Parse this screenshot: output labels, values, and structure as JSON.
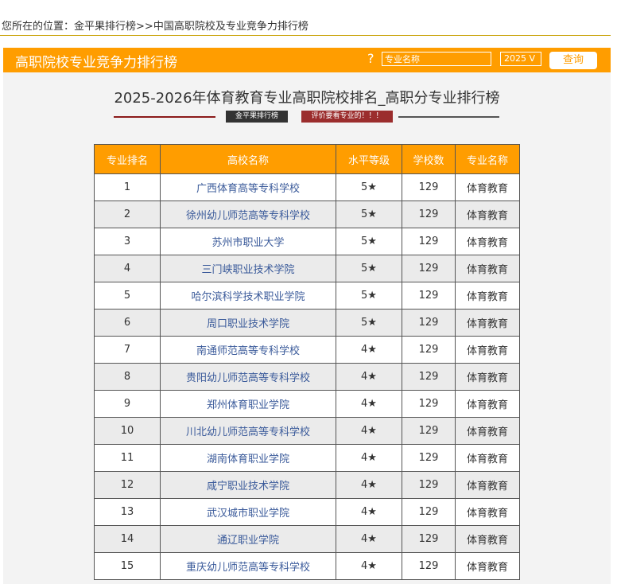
{
  "breadcrumb": {
    "prefix": "您所在的位置：",
    "home": "金平果排行榜",
    "sep": ">>",
    "current": "中国高职院校及专业竞争力排行榜"
  },
  "header": {
    "title": "高职院校专业竞争力排行榜",
    "help": "?",
    "search_placeholder": "专业名称",
    "year": "2025",
    "year_arrow": "V",
    "query_label": "查询"
  },
  "main": {
    "title": "2025-2026年体育教育专业高职院校排名_高职分专业排行榜",
    "badge_brand": "金平果排行榜",
    "badge_review": "评价要看专业的！！！"
  },
  "table": {
    "headers": [
      "专业排名",
      "高校名称",
      "水平等级",
      "学校数",
      "专业名称"
    ],
    "rows": [
      [
        "1",
        "广西体育高等专科学校",
        "5★",
        "129",
        "体育教育"
      ],
      [
        "2",
        "徐州幼儿师范高等专科学校",
        "5★",
        "129",
        "体育教育"
      ],
      [
        "3",
        "苏州市职业大学",
        "5★",
        "129",
        "体育教育"
      ],
      [
        "4",
        "三门峡职业技术学院",
        "5★",
        "129",
        "体育教育"
      ],
      [
        "5",
        "哈尔滨科学技术职业学院",
        "5★",
        "129",
        "体育教育"
      ],
      [
        "6",
        "周口职业技术学院",
        "5★",
        "129",
        "体育教育"
      ],
      [
        "7",
        "南通师范高等专科学校",
        "4★",
        "129",
        "体育教育"
      ],
      [
        "8",
        "贵阳幼儿师范高等专科学校",
        "4★",
        "129",
        "体育教育"
      ],
      [
        "9",
        "郑州体育职业学院",
        "4★",
        "129",
        "体育教育"
      ],
      [
        "10",
        "川北幼儿师范高等专科学校",
        "4★",
        "129",
        "体育教育"
      ],
      [
        "11",
        "湖南体育职业学院",
        "4★",
        "129",
        "体育教育"
      ],
      [
        "12",
        "咸宁职业技术学院",
        "4★",
        "129",
        "体育教育"
      ],
      [
        "13",
        "武汉城市职业学院",
        "4★",
        "129",
        "体育教育"
      ],
      [
        "14",
        "通辽职业学院",
        "4★",
        "129",
        "体育教育"
      ],
      [
        "15",
        "重庆幼儿师范高等专科学校",
        "4★",
        "129",
        "体育教育"
      ]
    ]
  },
  "colors": {
    "accent": "#ff9d00",
    "panel_bg": "#f3f3f3",
    "link": "#3a5a9a"
  }
}
